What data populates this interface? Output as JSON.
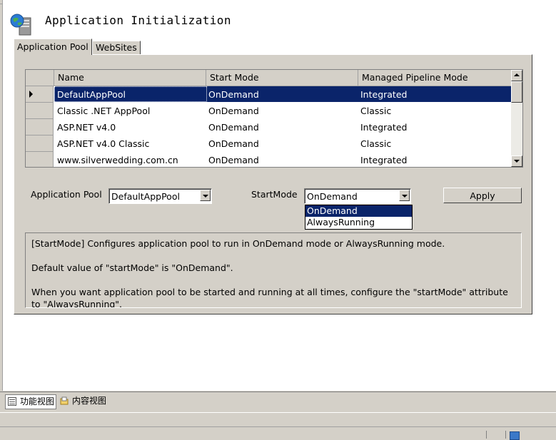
{
  "header": {
    "title": "Application Initialization",
    "icon": "server-globe-icon"
  },
  "tabs": [
    {
      "label": "Application Pool",
      "active": true
    },
    {
      "label": "WebSites",
      "active": false
    }
  ],
  "grid": {
    "columns": [
      "Name",
      "Start Mode",
      "Managed Pipeline Mode"
    ],
    "rows": [
      {
        "name": "DefaultAppPool",
        "start_mode": "OnDemand",
        "pipeline": "Integrated",
        "selected": true
      },
      {
        "name": "Classic .NET AppPool",
        "start_mode": "OnDemand",
        "pipeline": "Classic"
      },
      {
        "name": "ASP.NET v4.0",
        "start_mode": "OnDemand",
        "pipeline": "Integrated"
      },
      {
        "name": "ASP.NET v4.0 Classic",
        "start_mode": "OnDemand",
        "pipeline": "Classic"
      },
      {
        "name": "www.silverwedding.com.cn",
        "start_mode": "OnDemand",
        "pipeline": "Integrated"
      }
    ]
  },
  "form": {
    "app_pool_label": "Application Pool",
    "app_pool_value": "DefaultAppPool",
    "start_mode_label": "StartMode",
    "start_mode_value": "OnDemand",
    "start_mode_options": [
      "OnDemand",
      "AlwaysRunning"
    ],
    "apply_label": "Apply"
  },
  "description": {
    "line1": "[StartMode] Configures application pool to run in OnDemand mode or AlwaysRunning mode.",
    "line2": "Default value of \"startMode\" is \"OnDemand\".",
    "line3": "When you want application pool to be started and running at all times, configure the \"startMode\" attribute",
    "line4": "to \"AlwaysRunning\"."
  },
  "view_tabs": {
    "features": "功能视图",
    "content": "内容视图"
  },
  "colors": {
    "selection": "#0a246a",
    "chrome": "#d4d0c8"
  }
}
